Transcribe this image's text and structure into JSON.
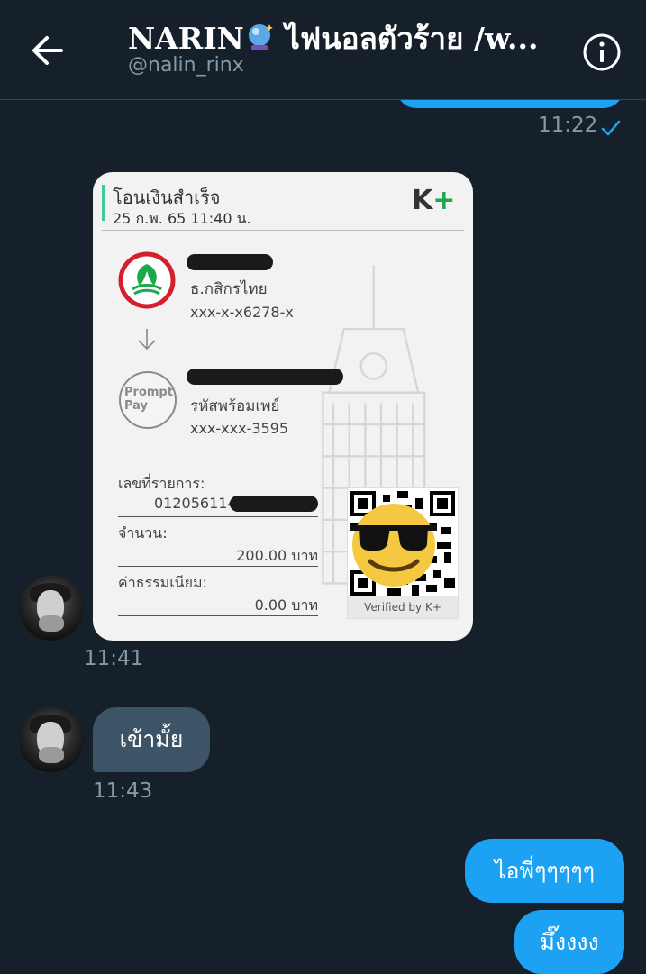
{
  "header": {
    "title": "NARIN",
    "title_rest": " ไฟนอลตัวร้าย /w...",
    "handle": "@nalin_rinx"
  },
  "messages": {
    "sent_time": "11:22",
    "slip_time": "11:41",
    "reply_text": "เข้ามั้ย",
    "reply_time": "11:43",
    "out1_text": "ไอพี่ๆๆๆๆๆ",
    "out2_text": "มึ๊งงงง"
  },
  "slip": {
    "title": "โอนเงินสำเร็จ",
    "date": "25 ก.พ. 65  11:40 น.",
    "brand": "K",
    "brand_plus": "+",
    "sender_bank": "ธ.กสิกรไทย",
    "sender_account": "xxx-x-x6278-x",
    "promptpay_line1": "Prompt",
    "promptpay_line2": "Pay",
    "receiver_type": "รหัสพร้อมเพย์",
    "receiver_account": "xxx-xxx-3595",
    "ref_label": "เลขที่รายการ:",
    "ref_value": "012056114",
    "amount_label": "จำนวน:",
    "amount_value": "200.00 บาท",
    "fee_label": "ค่าธรรมเนียม:",
    "fee_value": "0.00 บาท",
    "verified": "Verified by K+"
  },
  "icons": {
    "back": "arrow-left-icon",
    "info": "info-icon",
    "read": "check-icon",
    "globe": "crystal-ball-emoji",
    "emoji": "sunglasses-emoji"
  },
  "colors": {
    "background": "#15202b",
    "sent_bubble": "#1da1f2",
    "received_bubble": "#3d5466",
    "meta_text": "#8899a6",
    "kbank_green": "#1ba84a",
    "kbank_red": "#d4202c"
  }
}
